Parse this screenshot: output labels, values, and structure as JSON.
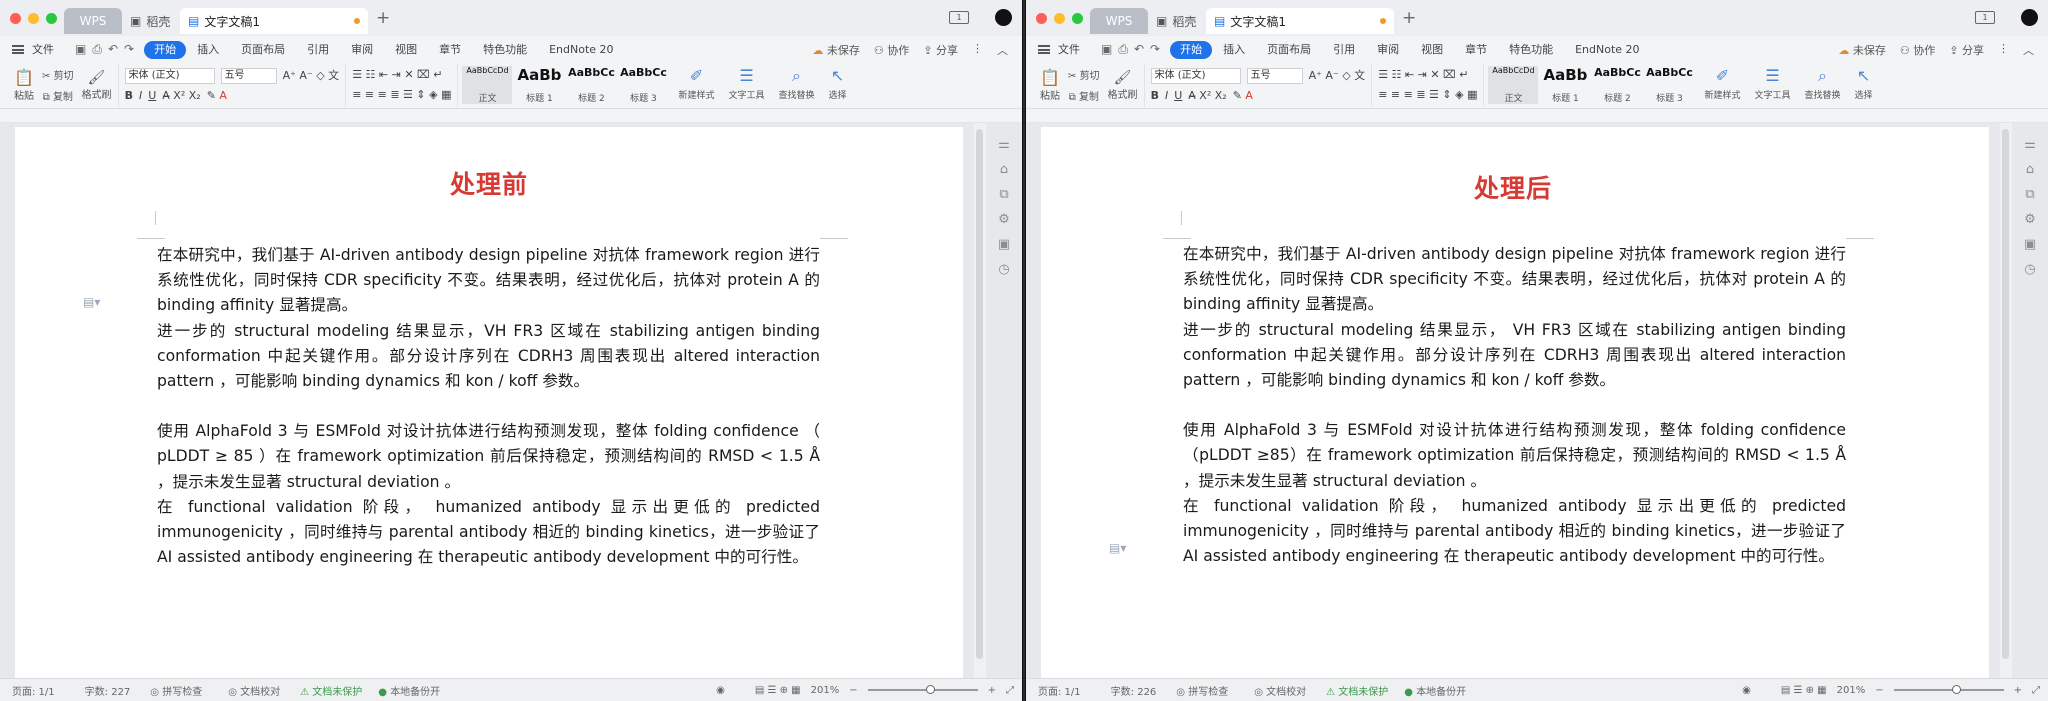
{
  "windows": [
    {
      "tabs": {
        "wps": "WPS",
        "find": "稻壳",
        "doc": "文字文稿1"
      },
      "menu": {
        "file": "文件",
        "items": [
          "开始",
          "插入",
          "页面布局",
          "引用",
          "审阅",
          "视图",
          "章节",
          "特色功能",
          "EndNote 20"
        ],
        "unsaved": "未保存",
        "collab": "协作",
        "share": "分享"
      },
      "ribbon": {
        "font": "宋体 (正文)",
        "size": "五号",
        "paste": "粘贴",
        "cut": "剪切",
        "copy": "复制",
        "format_painter": "格式刷",
        "styles": [
          {
            "preview": "AaBbCcDd",
            "name": "正文"
          },
          {
            "preview": "AaBb",
            "name": "标题 1"
          },
          {
            "preview": "AaBbCc",
            "name": "标题 2"
          },
          {
            "preview": "AaBbCc",
            "name": "标题 3"
          }
        ],
        "new_style": "新建样式",
        "text_tools": "文字工具",
        "find_replace": "查找替换",
        "select": "选择"
      },
      "doc_title": "处理前",
      "paragraphs": [
        "在本研究中，我们基于 AI-driven antibody design pipeline 对抗体 framework region 进行系统性优化，同时保持 CDR specificity 不变。结果表明，经过优化后，抗体对 protein A 的 binding affinity 显著提高。",
        "进一步的 structural modeling 结果显示，VH FR3 区域在 stabilizing antigen binding conformation 中起关键作用。部分设计序列在 CDRH3 周围表现出 altered interaction pattern ，可能影响 binding dynamics 和 kon / koff 参数。",
        "",
        "使用 AlphaFold 3 与 ESMFold 对设计抗体进行结构预测发现，整体 folding confidence （ pLDDT ≥ 85 ）在 framework optimization 前后保持稳定，预测结构间的 RMSD < 1.5 Å ，提示未发生显著 structural deviation 。",
        "在 functional validation 阶段， humanized antibody 显示出更低的 predicted immunogenicity ，同时维持与 parental antibody 相近的 binding kinetics，进一步验证了 AI assisted antibody engineering 在 therapeutic antibody development 中的可行性。"
      ],
      "status": {
        "page": "页面: 1/1",
        "words": "字数: 227",
        "spell": "拼写检查",
        "proof": "文档校对",
        "protect": "文档未保护",
        "backup": "本地备份开",
        "zoom": "201%"
      }
    },
    {
      "tabs": {
        "wps": "WPS",
        "find": "稻壳",
        "doc": "文字文稿1"
      },
      "menu": {
        "file": "文件",
        "items": [
          "开始",
          "插入",
          "页面布局",
          "引用",
          "审阅",
          "视图",
          "章节",
          "特色功能",
          "EndNote 20"
        ],
        "unsaved": "未保存",
        "collab": "协作",
        "share": "分享"
      },
      "ribbon": {
        "font": "宋体 (正文)",
        "size": "五号",
        "paste": "粘贴",
        "cut": "剪切",
        "copy": "复制",
        "format_painter": "格式刷",
        "styles": [
          {
            "preview": "AaBbCcDd",
            "name": "正文"
          },
          {
            "preview": "AaBb",
            "name": "标题 1"
          },
          {
            "preview": "AaBbCc",
            "name": "标题 2"
          },
          {
            "preview": "AaBbCc",
            "name": "标题 3"
          }
        ],
        "new_style": "新建样式",
        "text_tools": "文字工具",
        "find_replace": "查找替换",
        "select": "选择"
      },
      "doc_title": "处理后",
      "paragraphs": [
        "在本研究中，我们基于 AI-driven antibody design pipeline 对抗体 framework region 进行系统性优化，同时保持 CDR specificity 不变。结果表明，经过优化后，抗体对 protein A 的 binding affinity 显著提高。",
        "进一步的 structural modeling 结果显示， VH FR3 区域在 stabilizing antigen binding conformation 中起关键作用。部分设计序列在 CDRH3 周围表现出 altered interaction pattern ，可能影响 binding dynamics 和 kon / koff 参数。",
        "",
        "使用 AlphaFold 3 与 ESMFold 对设计抗体进行结构预测发现，整体 folding confidence（pLDDT ≥85）在 framework optimization 前后保持稳定，预测结构间的 RMSD < 1.5 Å ，提示未发生显著 structural deviation 。",
        "在 functional validation 阶段， humanized antibody 显示出更低的 predicted immunogenicity ，同时维持与 parental antibody 相近的 binding kinetics，进一步验证了 AI assisted antibody engineering 在 therapeutic antibody development 中的可行性。"
      ],
      "status": {
        "page": "页面: 1/1",
        "words": "字数: 226",
        "spell": "拼写检查",
        "proof": "文档校对",
        "protect": "文档未保护",
        "backup": "本地备份开",
        "zoom": "201%"
      }
    }
  ],
  "colors": {
    "accent": "#1f72e8",
    "title_red": "#d73a33",
    "tab_dot": "#f39a1f",
    "status_green": "#3c9a4b"
  },
  "icons": [
    "close-light",
    "minimize-light",
    "maximize-light",
    "save-icon",
    "undo-icon",
    "redo-icon",
    "search-icon",
    "cloud-icon",
    "share-icon"
  ]
}
